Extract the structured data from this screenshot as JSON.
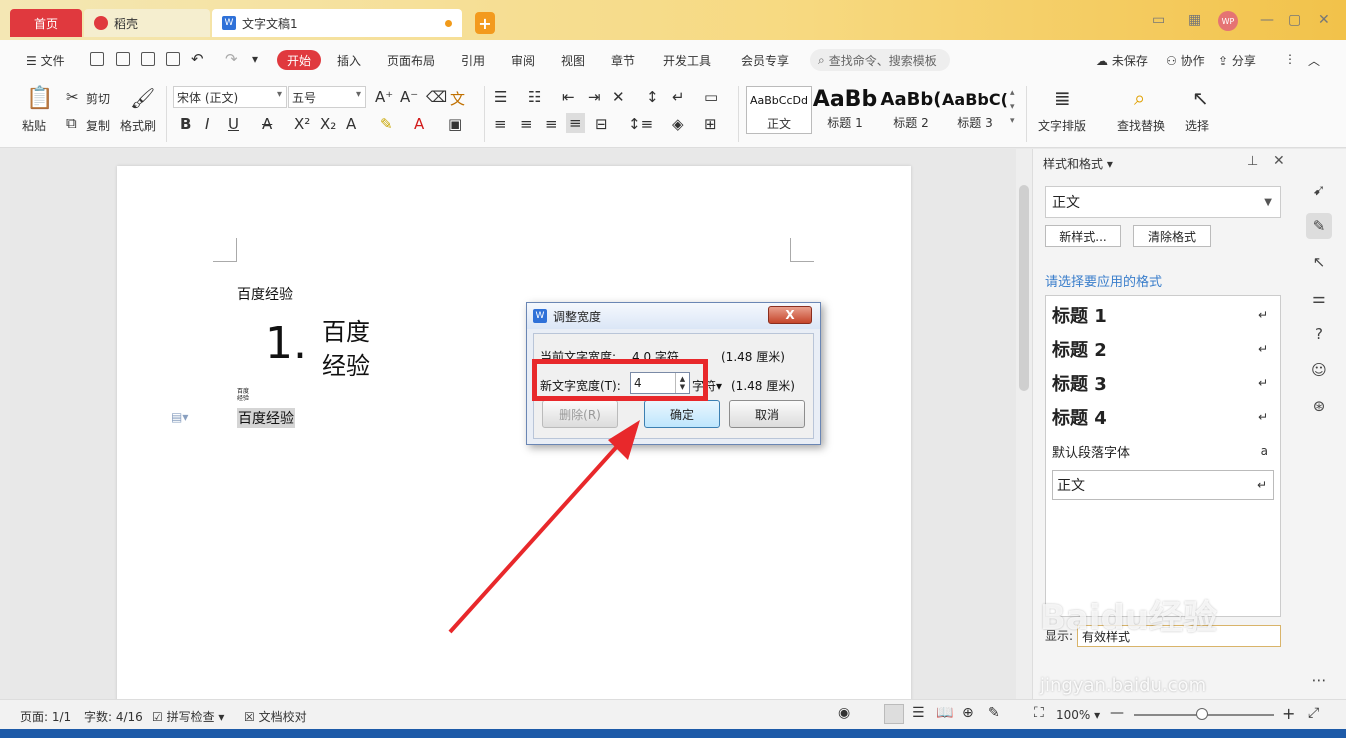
{
  "tabs": {
    "home": "首页",
    "docer": "稻壳",
    "doc": "文字文稿1"
  },
  "menu": {
    "file": "文件",
    "items": [
      "开始",
      "插入",
      "页面布局",
      "引用",
      "审阅",
      "视图",
      "章节",
      "开发工具",
      "会员专享"
    ],
    "search_placeholder": "查找命令、搜索模板",
    "unsaved": "未保存",
    "collab": "协作",
    "share": "分享"
  },
  "ribbon": {
    "paste": "粘贴",
    "cut": "剪切",
    "copy": "复制",
    "format_painter": "格式刷",
    "font_name": "宋体 (正文)",
    "font_size": "五号",
    "styles": [
      {
        "preview": "AaBbCcDd",
        "name": "正文"
      },
      {
        "preview": "AaBb",
        "name": "标题 1"
      },
      {
        "preview": "AaBb(",
        "name": "标题 2"
      },
      {
        "preview": "AaBbC(",
        "name": "标题 3"
      }
    ],
    "text_layout": "文字排版",
    "find_replace": "查找替换",
    "select": "选择"
  },
  "document": {
    "line1": "百度经验",
    "list_number": "1.",
    "combined_top": "百度",
    "combined_bottom": "经验",
    "small_top": "百度",
    "small_bottom": "经验",
    "selected": "百度经验"
  },
  "pane": {
    "title": "样式和格式",
    "current_style": "正文",
    "new_style": "新样式...",
    "clear_format": "清除格式",
    "hint": "请选择要应用的格式",
    "items": [
      {
        "label": "标题  1",
        "mark": "↵"
      },
      {
        "label": "标题  2",
        "mark": "↵"
      },
      {
        "label": "标题  3",
        "mark": "↵"
      },
      {
        "label": "标题  4",
        "mark": "↵"
      },
      {
        "label": "默认段落字体",
        "mark": "a"
      },
      {
        "label": "正文",
        "mark": "↵"
      }
    ],
    "show_label": "显示:",
    "show_value": "有效样式"
  },
  "status": {
    "page": "页面: 1/1",
    "words": "字数: 4/16",
    "spell": "拼写检查",
    "proof": "文档校对",
    "zoom": "100%"
  },
  "dialog": {
    "title": "调整宽度",
    "close": "X",
    "current_label": "当前文字宽度:",
    "current_value": "4.0 字符",
    "current_cm": "(1.48 厘米)",
    "new_label": "新文字宽度(T):",
    "new_value": "4",
    "unit": "字符",
    "new_cm": "(1.48 厘米)",
    "delete": "删除(R)",
    "ok": "确定",
    "cancel": "取消"
  },
  "watermark": {
    "main": "Baidu经验",
    "url": "jingyan.baidu.com"
  }
}
